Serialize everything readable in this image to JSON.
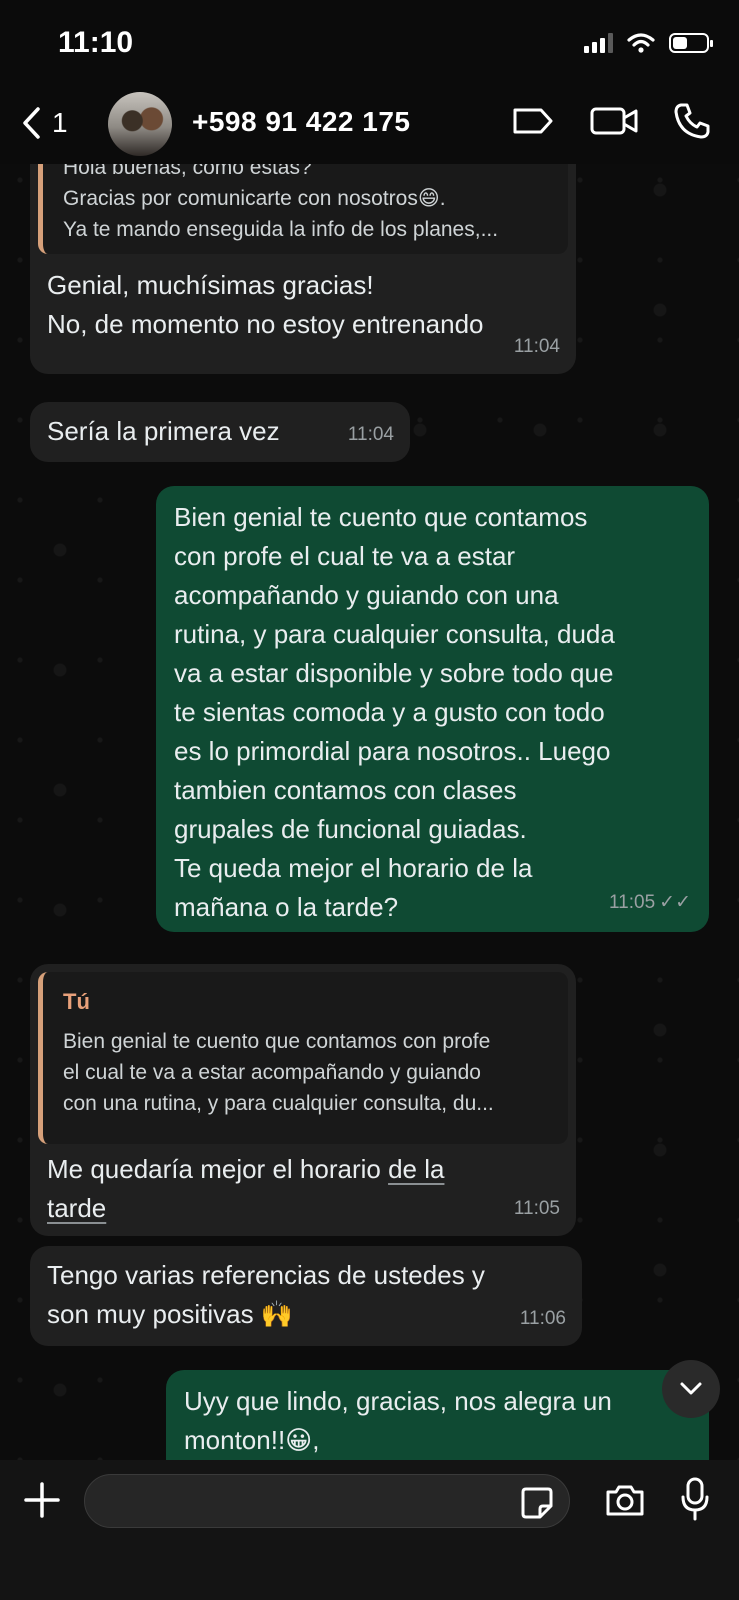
{
  "status_bar": {
    "time": "11:10"
  },
  "header": {
    "back_count": "1",
    "contact": "+598 91 422 175"
  },
  "messages": [
    {
      "direction": "in",
      "quote_lines": [
        "Hola buenas, como estas?",
        "Gracias por comunicarte con nosotros😄.",
        "Ya te mando enseguida la info de los planes,..."
      ],
      "lines": [
        "Genial, muchísimas gracias!",
        "No, de momento no estoy entrenando"
      ],
      "time": "11:04"
    },
    {
      "direction": "in",
      "text": "Sería la primera vez",
      "time": "11:04"
    },
    {
      "direction": "out",
      "lines": [
        "Bien genial te cuento que contamos",
        "con profe el cual te va a estar",
        "acompañando y guiando con una",
        "rutina, y para cualquier consulta, duda",
        "va a estar disponible y sobre todo que",
        "te sientas comoda y a gusto con todo",
        "es lo primordial para nosotros.. Luego",
        "tambien contamos con clases",
        "grupales de funcional guiadas.",
        "Te queda mejor el horario de la",
        "mañana o la tarde?"
      ],
      "time": "11:05",
      "ticks": "✓✓"
    },
    {
      "direction": "in",
      "quote_author": "Tú",
      "quote_lines": [
        "Bien genial te cuento que contamos con profe",
        "el cual te va a estar acompañando y guiando",
        "con una rutina, y para cualquier consulta, du..."
      ],
      "line1_a": "Me quedaría mejor el horario ",
      "line1_b": "de la",
      "line2": "tarde",
      "time": "11:05"
    },
    {
      "direction": "in",
      "lines": [
        "Tengo varias referencias de ustedes y",
        "son muy positivas 🙌"
      ],
      "time": "11:06"
    },
    {
      "direction": "out",
      "lines": [
        "Uyy que lindo, gracias, nos alegra un",
        "monton!!😀,"
      ]
    }
  ],
  "composer": {
    "placeholder": ""
  },
  "colors": {
    "outgoing": "#0f4a33",
    "incoming": "#202020",
    "quote_bar": "#d6a07a"
  }
}
